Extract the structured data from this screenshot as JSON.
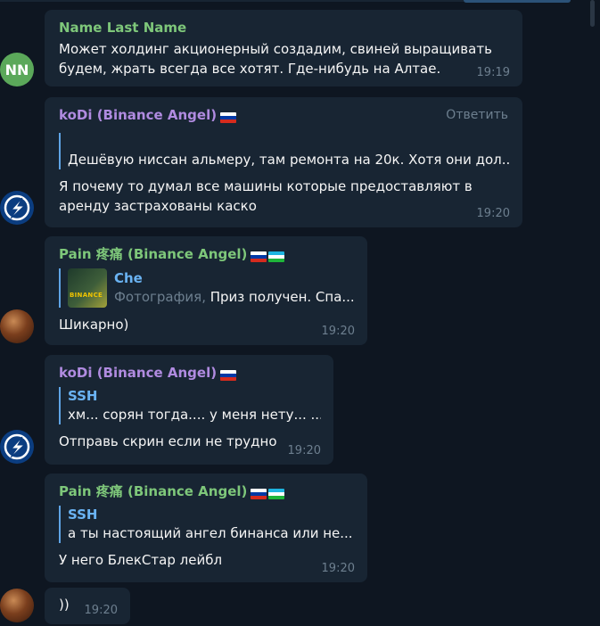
{
  "messages": [
    {
      "sender": "Name Last Name",
      "avatar_initials": "NN",
      "text_line1": "Может холдинг акционерный создадим, свиней выращивать",
      "text_line2": "будем, жрать всегда все хотят. Где-нибудь на Алтае.",
      "time": "19:19"
    },
    {
      "sender": "koDi (Binance Angel)",
      "flags": [
        "ru"
      ],
      "reply_label": "Ответить",
      "quote_text": "Дешёвую ниссан альмеру, там ремонта на 20к. Хотя они дол...",
      "text_line1": "Я почему то думал все машины которые предоставляют в",
      "text_line2": "аренду застрахованы каско",
      "time": "19:20"
    },
    {
      "sender": "Pain 疼痛 (Binance Angel)",
      "flags": [
        "ru",
        "uz"
      ],
      "quote_name": "Che",
      "quote_muted": "Фотография, ",
      "quote_text": "Приз получен. Спа...",
      "thumb_label": "BINANCE",
      "text": "Шикарно)",
      "time": "19:20"
    },
    {
      "sender": "koDi (Binance Angel)",
      "flags": [
        "ru"
      ],
      "quote_name": "SSH",
      "quote_text": "хм... сорян тогда.... у меня нету... ...",
      "text": "Отправь скрин если не трудно",
      "time": "19:20"
    },
    {
      "sender": "Pain 疼痛 (Binance Angel)",
      "flags": [
        "ru",
        "uz"
      ],
      "quote_name": "SSH",
      "quote_text": "а ты настоящий ангел бинанса или не...",
      "text": "У него БлекСтар лейбл",
      "time": "19:20"
    },
    {
      "text": "))",
      "time": "19:20"
    }
  ],
  "colors": {
    "background": "#0e1621",
    "bubble": "#182533",
    "sender_green": "#7ec77a",
    "sender_purple": "#b08be0",
    "quote_accent": "#6ab3f3",
    "time": "#6d7f8f"
  },
  "icons": {
    "avatar_kodi": "lightning-bolt-icon",
    "avatar_pain": "monkey-avatar",
    "flag_ru": "russia-flag-icon",
    "flag_uz": "uzbekistan-flag-icon"
  }
}
